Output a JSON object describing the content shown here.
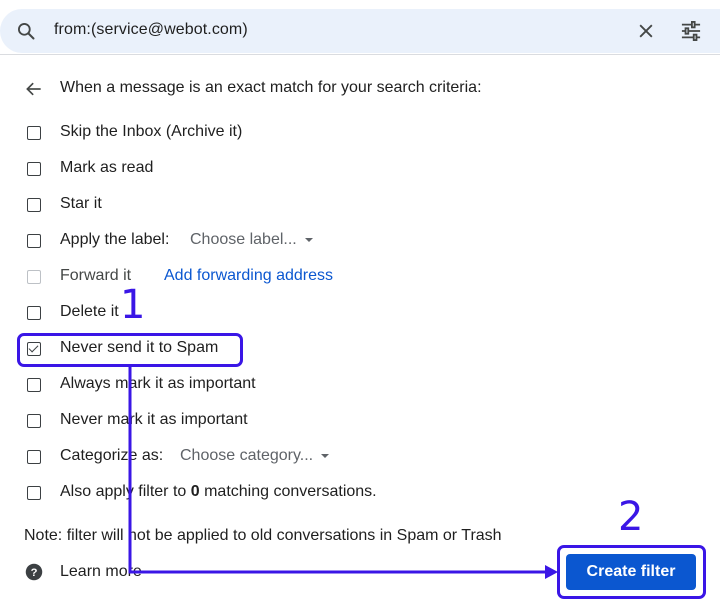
{
  "search": {
    "query": "from:(service@webot.com)",
    "icon": "search-icon",
    "clear_icon": "close-icon",
    "options_icon": "tune-icon"
  },
  "heading": "When a message is an exact match for your search criteria:",
  "options": [
    {
      "label": "Skip the Inbox (Archive it)",
      "checked": false
    },
    {
      "label": "Mark as read",
      "checked": false
    },
    {
      "label": "Star it",
      "checked": false
    },
    {
      "label": "Apply the label:",
      "checked": false,
      "dropdown": "Choose label..."
    },
    {
      "label": "Forward it",
      "checked": false,
      "disabled": true,
      "link": "Add forwarding address"
    },
    {
      "label": "Delete it",
      "checked": false
    },
    {
      "label": "Never send it to Spam",
      "checked": true
    },
    {
      "label": "Always mark it as important",
      "checked": false
    },
    {
      "label": "Never mark it as important",
      "checked": false
    },
    {
      "label": "Categorize as:",
      "checked": false,
      "dropdown": "Choose category..."
    },
    {
      "label_prefix": "Also apply filter to ",
      "count": "0",
      "label_suffix": " matching conversations.",
      "checked": false
    }
  ],
  "note": "Note: filter will not be applied to old conversations in Spam or Trash",
  "learn_more": "Learn more",
  "create_button": "Create filter",
  "annotations": {
    "step1": "1",
    "step2": "2",
    "color": "#3a16e6"
  },
  "colors": {
    "accent": "#0b57d0",
    "search_bg": "#eaf1fb"
  }
}
